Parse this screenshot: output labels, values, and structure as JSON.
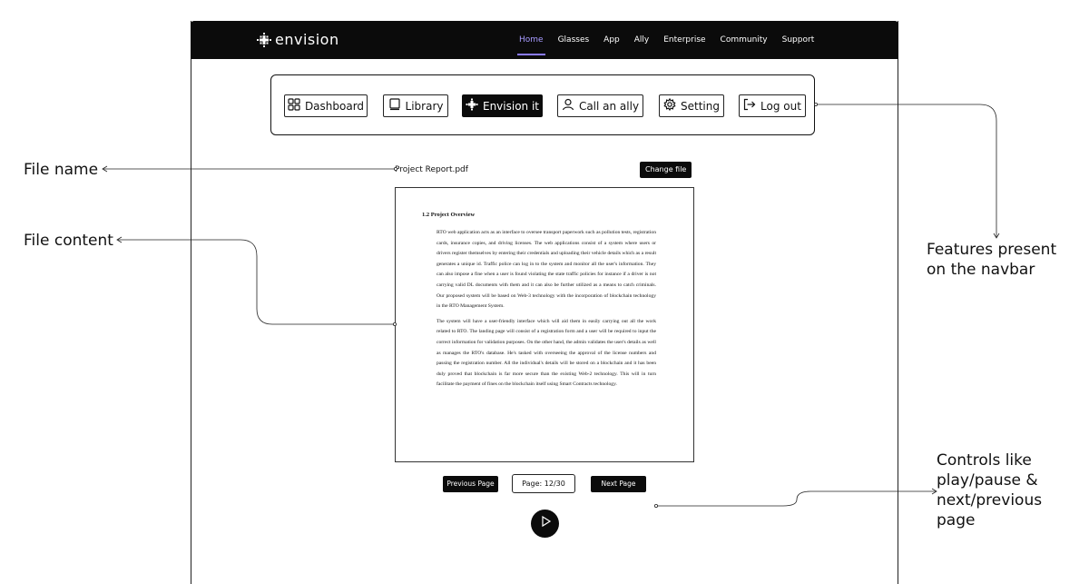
{
  "header": {
    "brand": "envision",
    "nav": [
      "Home",
      "Glasses",
      "App",
      "Ally",
      "Enterprise",
      "Community",
      "Support"
    ],
    "active_nav": "Home",
    "accent_color": "#8a7bff"
  },
  "toolbar": {
    "items": [
      {
        "label": "Dashboard",
        "icon": "grid-icon"
      },
      {
        "label": "Library",
        "icon": "book-icon"
      },
      {
        "label": "Envision it",
        "icon": "envision-icon"
      },
      {
        "label": "Call an ally",
        "icon": "user-icon"
      },
      {
        "label": "Setting",
        "icon": "gear-icon"
      },
      {
        "label": "Log out",
        "icon": "logout-icon"
      }
    ]
  },
  "file": {
    "name": "Project Report.pdf",
    "change_label": "Change file"
  },
  "document": {
    "heading": "1.2 Project Overview",
    "paragraphs": [
      "RTO web application acts as an interface to oversee transport paperwork such as pollution tests, registration cards, insurance copies, and driving licenses. The web applications consist of a system where users or drivers register themselves by entering their credentials and uploading their vehicle details which as a result generates a unique id. Traffic police can log in to the system and monitor all the user's information. They can also impose a fine when a user is found violating the state traffic policies for instance if a driver is not carrying valid DL documents with them and it can also be further utilized as a means to catch criminals. Our proposed system will be based on Web-3 technology with the incorporation of blockchain technology in the RTO Management System.",
      "The system will have a user-friendly interface which will aid them in easily carrying out all the work related to RTO. The landing page will consist of a registration form and a user will be required to input the correct information for validation purposes. On the other hand, the admin validates the user's details as well as manages the RTO's database. He's tasked with overseeing the approval of the license numbers and passing the registration number. All the individual's details will be stored on a blockchain and it has been duly proved that blockchain is far more secure than the existing Web-2 technology. This will in turn facilitate the payment of fines on the blockchain itself using Smart Contracts technology."
    ]
  },
  "controls": {
    "prev_label": "Previous Page",
    "page_label": "Page: 12/30",
    "next_label": "Next Page",
    "play_icon": "play-icon"
  },
  "annotations": {
    "file_name": "File name",
    "file_content": "File content",
    "features_line1": "Features present",
    "features_line2": "on the navbar",
    "controls_line1": "Controls like",
    "controls_line2": "play/pause &",
    "controls_line3": "next/previous",
    "controls_line4": "page"
  }
}
